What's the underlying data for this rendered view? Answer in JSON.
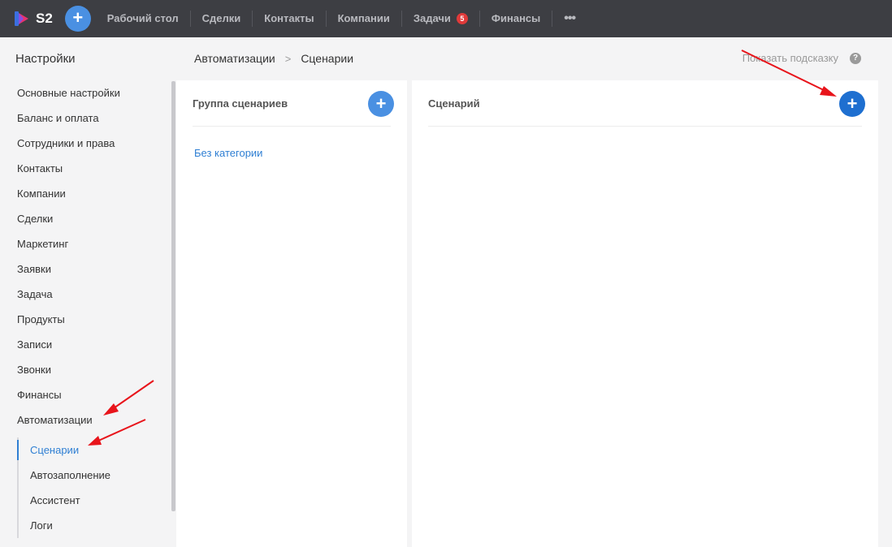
{
  "app": {
    "logo_text": "S2"
  },
  "topnav": {
    "items": [
      {
        "label": "Рабочий стол"
      },
      {
        "label": "Сделки"
      },
      {
        "label": "Контакты"
      },
      {
        "label": "Компании"
      },
      {
        "label": "Задачи",
        "badge": "5"
      },
      {
        "label": "Финансы"
      }
    ],
    "more": "•••"
  },
  "sidebar": {
    "title": "Настройки",
    "items": [
      {
        "label": "Основные настройки"
      },
      {
        "label": "Баланс и оплата"
      },
      {
        "label": "Сотрудники и права"
      },
      {
        "label": "Контакты"
      },
      {
        "label": "Компании"
      },
      {
        "label": "Сделки"
      },
      {
        "label": "Маркетинг"
      },
      {
        "label": "Заявки"
      },
      {
        "label": "Задача"
      },
      {
        "label": "Продукты"
      },
      {
        "label": "Записи"
      },
      {
        "label": "Звонки"
      },
      {
        "label": "Финансы"
      },
      {
        "label": "Автоматизации"
      }
    ],
    "subitems": [
      {
        "label": "Сценарии",
        "active": true
      },
      {
        "label": "Автозаполнение"
      },
      {
        "label": "Ассистент"
      },
      {
        "label": "Логи"
      }
    ]
  },
  "breadcrumb": {
    "parent": "Автоматизации",
    "separator": ">",
    "current": "Сценарии"
  },
  "hint": {
    "label": "Показать подсказку",
    "icon": "?"
  },
  "left_panel": {
    "title": "Группа сценариев",
    "category": "Без категории"
  },
  "right_panel": {
    "title": "Сценарий"
  },
  "colors": {
    "accent": "#4a90e2",
    "topbar": "#3d3e43",
    "badge": "#e03a3a",
    "annotation": "#e8141b"
  }
}
